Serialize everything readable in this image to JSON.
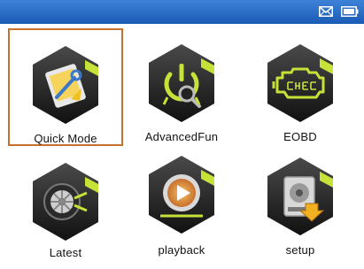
{
  "status_bar": {
    "icons": [
      "mail-icon",
      "battery-icon"
    ],
    "color": "#2a6cc6"
  },
  "menu": {
    "selected": "Quick Mode",
    "accent_color": "#c8702e",
    "items": [
      {
        "label": "Quick Mode",
        "icon": "quick-mode-icon"
      },
      {
        "label": "AdvancedFun",
        "icon": "advanced-fun-icon"
      },
      {
        "label": "EOBD",
        "icon": "eobd-engine-icon"
      },
      {
        "label": "Latest",
        "icon": "latest-wheel-icon"
      },
      {
        "label": "playback",
        "icon": "playback-icon"
      },
      {
        "label": "setup",
        "icon": "setup-icon"
      }
    ]
  }
}
